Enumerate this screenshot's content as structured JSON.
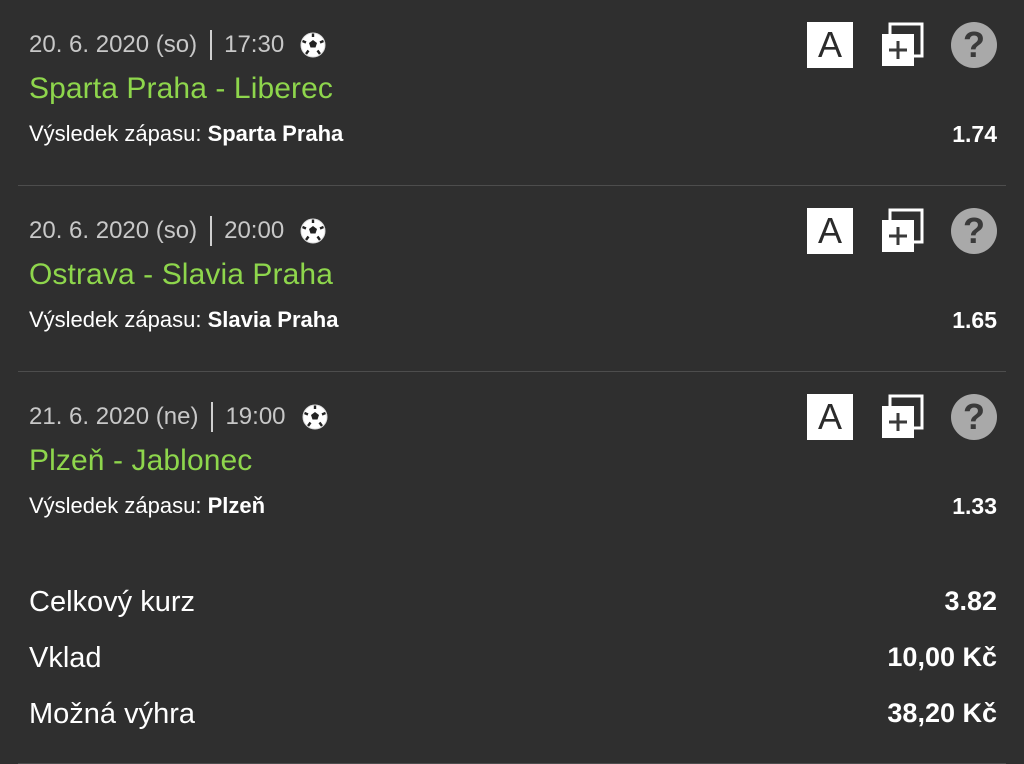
{
  "matches": [
    {
      "date": "20. 6. 2020 (so)",
      "time": "17:30",
      "teams": "Sparta Praha - Liberec",
      "bet_label": "Výsledek zápasu:",
      "bet_pick": "Sparta Praha",
      "odd": "1.74"
    },
    {
      "date": "20. 6. 2020 (so)",
      "time": "20:00",
      "teams": "Ostrava - Slavia Praha",
      "bet_label": "Výsledek zápasu:",
      "bet_pick": "Slavia Praha",
      "odd": "1.65"
    },
    {
      "date": "21. 6. 2020 (ne)",
      "time": "19:00",
      "teams": "Plzeň - Jablonec",
      "bet_label": "Výsledek zápasu:",
      "bet_pick": "Plzeň",
      "odd": "1.33"
    }
  ],
  "icons": {
    "sport": "soccer-ball-icon",
    "a_label": "A",
    "help_label": "?"
  },
  "summary": {
    "total_odds_label": "Celkový kurz",
    "total_odds_value": "3.82",
    "stake_label": "Vklad",
    "stake_value": "10,00 Kč",
    "win_label": "Možná výhra",
    "win_value": "38,20 Kč"
  },
  "colors": {
    "team_green": "#8ed64c",
    "panel_bg": "#3a3a3a",
    "summary_bg": "#2f2f2f"
  }
}
